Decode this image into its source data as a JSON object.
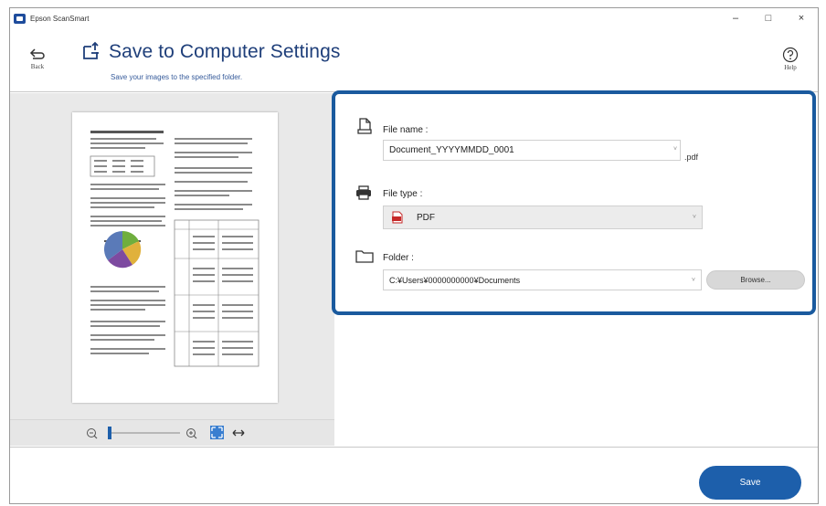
{
  "window": {
    "app_title": "Epson ScanSmart",
    "controls": {
      "minimize": "–",
      "maximize": "□",
      "close": "×"
    }
  },
  "header": {
    "back_label": "Back",
    "title": "Save to Computer Settings",
    "subtitle": "Save your images to the specified folder.",
    "help_label": "Help"
  },
  "settings": {
    "file_name": {
      "label": "File name :",
      "value": "Document_YYYYMMDD_0001",
      "extension": ".pdf"
    },
    "file_type": {
      "label": "File type :",
      "selected": "PDF"
    },
    "folder": {
      "label": "Folder :",
      "value": "C:¥Users¥0000000000¥Documents",
      "browse_label": "Browse..."
    }
  },
  "zoom": {
    "level": 0.0
  },
  "footer": {
    "save_label": "Save"
  },
  "colors": {
    "accent": "#1a5a9e",
    "title": "#1f3f7a",
    "save_button": "#1d5fab"
  },
  "icons": [
    "back-arrow-icon",
    "save-to-computer-icon",
    "help-icon",
    "file-icon",
    "printer-icon",
    "folder-icon",
    "pdf-icon",
    "zoom-out-icon",
    "zoom-in-icon",
    "fit-page-icon",
    "expand-icon"
  ]
}
